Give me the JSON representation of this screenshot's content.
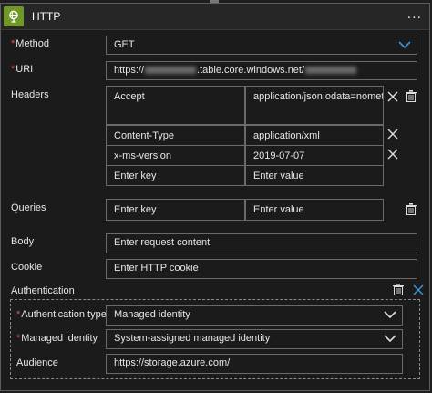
{
  "card": {
    "title": "HTTP",
    "more": "..."
  },
  "method": {
    "label": "Method",
    "value": "GET"
  },
  "uri": {
    "label": "URI",
    "prefix": "https://",
    "middle": ".table.core.windows.net/"
  },
  "headers": {
    "label": "Headers",
    "rows": [
      {
        "key": "Accept",
        "value": "application/json;odata=nometadata"
      },
      {
        "key": "Content-Type",
        "value": "application/xml"
      },
      {
        "key": "x-ms-version",
        "value": "2019-07-07"
      },
      {
        "key": "Enter key",
        "value": "Enter value"
      }
    ]
  },
  "queries": {
    "label": "Queries",
    "key_placeholder": "Enter key",
    "value_placeholder": "Enter value"
  },
  "body": {
    "label": "Body",
    "placeholder": "Enter request content"
  },
  "cookie": {
    "label": "Cookie",
    "placeholder": "Enter HTTP cookie"
  },
  "authentication": {
    "label": "Authentication",
    "type_label": "Authentication type",
    "type_value": "Managed identity",
    "identity_label": "Managed identity",
    "identity_value": "System-assigned managed identity",
    "audience_label": "Audience",
    "audience_value": "https://storage.azure.com/"
  },
  "colors": {
    "accent": "#709727",
    "required": "#e05252",
    "link_blue": "#3a96dd"
  },
  "icons": [
    "http-globe-icon",
    "more-icon",
    "chevron-down-icon",
    "close-icon",
    "delete-icon"
  ]
}
